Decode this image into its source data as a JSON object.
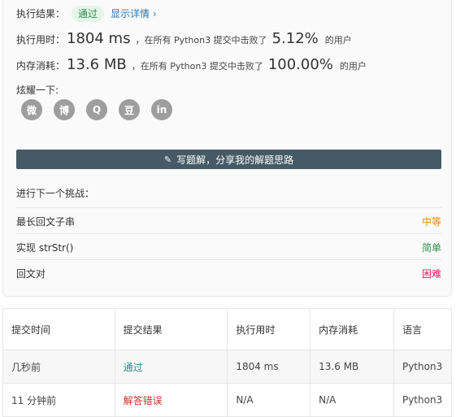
{
  "result": {
    "label": "执行结果：",
    "status": "通过",
    "detail_link": "显示详情 ›"
  },
  "runtime": {
    "label": "执行用时：",
    "value": "1804 ms",
    "mid": "，在所有 Python3 提交中击败了",
    "percent": "5.12%",
    "suffix": "的用户"
  },
  "memory": {
    "label": "内存消耗：",
    "value": "13.6 MB",
    "mid": "，在所有 Python3 提交中击败了",
    "percent": "100.00%",
    "suffix": "的用户"
  },
  "share": {
    "label": "炫耀一下:",
    "icons": [
      "wechat-icon",
      "weibo-icon",
      "qq-icon",
      "douban-icon",
      "linkedin-icon"
    ],
    "glyphs": [
      "微",
      "博",
      "Q",
      "豆",
      "in"
    ]
  },
  "write_button": "写题解，分享我的解题思路",
  "next_challenge_label": "进行下一个挑战：",
  "problems": [
    {
      "title": "最长回文子串",
      "difficulty": "中等"
    },
    {
      "title": "实现 strStr()",
      "difficulty": "简单"
    },
    {
      "title": "回文对",
      "difficulty": "困难"
    }
  ],
  "table": {
    "headers": [
      "提交时间",
      "提交结果",
      "执行用时",
      "内存消耗",
      "语言"
    ],
    "rows": [
      {
        "time": "几秒前",
        "result": "通过",
        "runtime": "1804 ms",
        "memory": "13.6 MB",
        "lang": "Python3"
      },
      {
        "time": "11 分钟前",
        "result": "解答错误",
        "runtime": "N/A",
        "memory": "N/A",
        "lang": "Python3"
      }
    ]
  },
  "colors": {
    "pass": "#2f8f4e",
    "error": "#d0302f",
    "medium": "#e48a12",
    "hard": "#e0245e",
    "button": "#455a64"
  }
}
